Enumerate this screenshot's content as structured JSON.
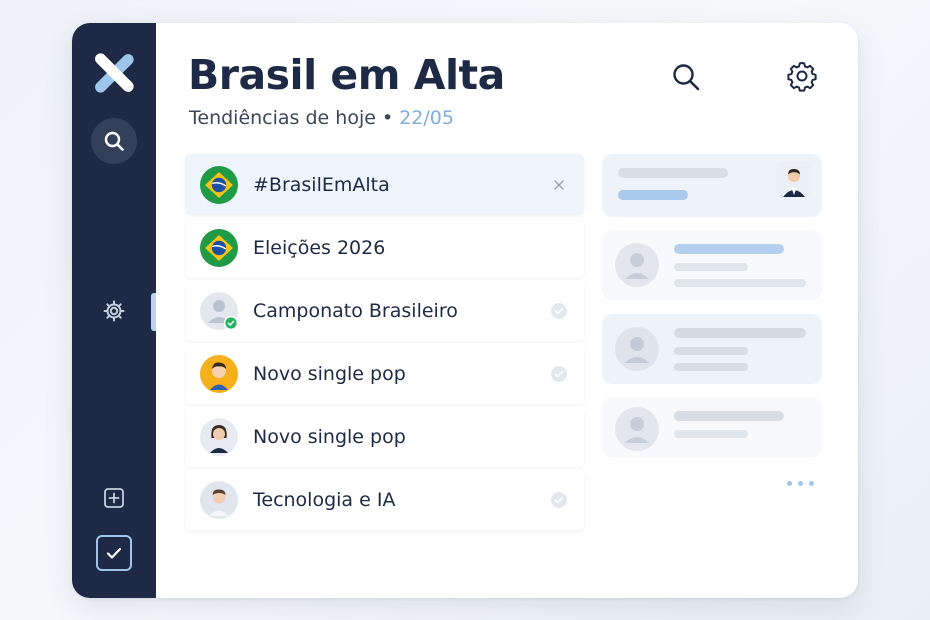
{
  "app": {
    "title": "Brasil em Alta",
    "subtitle_prefix": "Tendiências de hoje • ",
    "subtitle_date": "22/05"
  },
  "colors": {
    "sidebar": "#1e2a45",
    "accent": "#7faed9",
    "selected_row": "#eef4fc"
  },
  "sidebar": {
    "items": [
      {
        "icon": "logo-icon"
      },
      {
        "icon": "search-icon"
      },
      {
        "icon": "gear-icon"
      },
      {
        "icon": "add-icon"
      },
      {
        "icon": "checkbox-icon"
      }
    ]
  },
  "header": {
    "icons": [
      "search-icon",
      "gear-icon"
    ]
  },
  "trends": [
    {
      "label": "#BrasilEmAlta",
      "avatar": "brazil-flag-icon",
      "trail": "close-icon",
      "selected": true
    },
    {
      "label": "Eleições 2026",
      "avatar": "brazil-flag-icon",
      "trail": null,
      "selected": false
    },
    {
      "label": "Camponato Brasileiro",
      "avatar": "verified-user-avatar",
      "trail": "check-circle-icon",
      "selected": false
    },
    {
      "label": "Novo single pop",
      "avatar": "user-avatar-yellow",
      "trail": "check-circle-icon",
      "selected": false
    },
    {
      "label": "Novo single pop",
      "avatar": "user-avatar-woman",
      "trail": null,
      "selected": false
    },
    {
      "label": "Tecnologia e IA",
      "avatar": "user-avatar-man",
      "trail": "check-circle-icon",
      "selected": false
    }
  ]
}
